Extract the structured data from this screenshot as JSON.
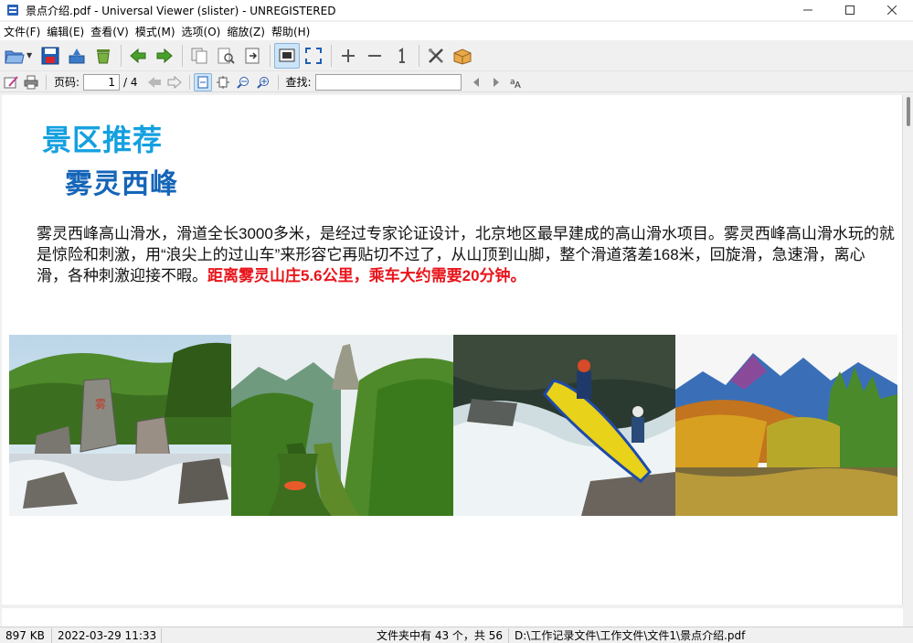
{
  "window": {
    "title": "景点介绍.pdf - Universal Viewer (slister) - UNREGISTERED"
  },
  "menu": {
    "items": [
      "文件(F)",
      "编辑(E)",
      "查看(V)",
      "模式(M)",
      "选项(O)",
      "缩放(Z)",
      "帮助(H)"
    ]
  },
  "toolbar": {
    "icons": [
      "open-folder-icon",
      "save-icon",
      "export-icon",
      "recycle-icon",
      "back-arrow-icon",
      "forward-arrow-icon",
      "copy-icon",
      "print-preview-icon",
      "exit-doc-icon",
      "fit-window-icon",
      "fullscreen-icon",
      "zoom-in-icon",
      "zoom-out-icon",
      "original-size-icon",
      "settings-icon",
      "package-icon"
    ]
  },
  "nav": {
    "page_label": "页码:",
    "page_current": "1",
    "page_total": "/ 4",
    "find_label": "查找:",
    "find_value": ""
  },
  "document": {
    "heading1": "景区推荐",
    "heading2": "雾灵西峰",
    "paragraph": "雾灵西峰高山滑水，滑道全长3000多米，是经过专家论证设计，北京地区最早建成的高山滑水项目。雾灵西峰高山滑水玩的就是惊险和刺激，用“浪尖上的过山车”来形容它再贴切不过了，从山顶到山脚，整个滑道落差168米，回旋滑，急速滑，离心滑，各种刺激迎接不暇。",
    "highlight": "距离雾灵山庄5.6公里，乘车大约需要20分钟。",
    "colors": {
      "heading1": "#14a0e0",
      "heading2": "#1565b8",
      "highlight": "#e8141b"
    }
  },
  "status": {
    "size": "897 KB",
    "date": "2022-03-29 11:33",
    "count": "文件夹中有 43 个，共 56",
    "path": "D:\\工作记录文件\\工作文件\\文件1\\景点介绍.pdf"
  }
}
